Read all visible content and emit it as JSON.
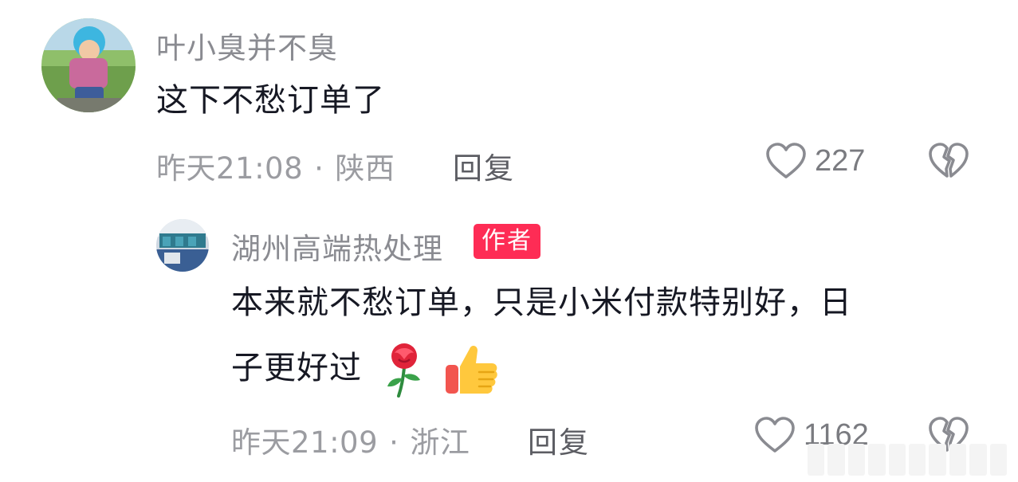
{
  "comments": [
    {
      "username": "叶小臭并不臭",
      "text": "这下不愁订单了",
      "time": "昨天21:08",
      "location": "陕西",
      "reply_label": "回复",
      "likes": "227"
    },
    {
      "username": "湖州高端热处理",
      "badge": "作者",
      "text_line1": "本来就不愁订单，只是小米付款特别好，日",
      "text_line2": "子更好过",
      "time": "昨天21:09",
      "location": "浙江",
      "reply_label": "回复",
      "likes": "1162"
    }
  ],
  "separator": "·",
  "colors": {
    "badge": "#fe2c55",
    "username": "#8a8b91",
    "meta": "#9b9ca1"
  },
  "icons": [
    "heart-outline-icon",
    "broken-heart-icon",
    "rose-emoji",
    "thumbs-up-emoji"
  ]
}
